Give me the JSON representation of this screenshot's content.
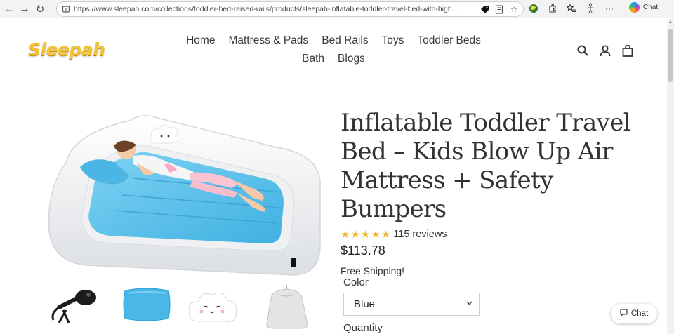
{
  "browser": {
    "url": "https://www.sleepah.com/collections/toddler-bed-raised-rails/products/sleepah-inflatable-toddler-travel-bed-with-high...",
    "chat_label": "Chat"
  },
  "header": {
    "logo_text": "Sleepah",
    "nav_row1": [
      "Home",
      "Mattress & Pads",
      "Bed Rails",
      "Toys",
      "Toddler Beds"
    ],
    "nav_row2": [
      "Bath",
      "Blogs"
    ],
    "active_nav": "Toddler Beds"
  },
  "product": {
    "title": "Inflatable Toddler Travel Bed – Kids Blow Up Air Mattress + Safety Bumpers",
    "rating_stars": 5,
    "reviews": "115 reviews",
    "price": "$113.78",
    "shipping": "Free Shipping!",
    "color_label": "Color",
    "color_value": "Blue",
    "quantity_label": "Quantity"
  },
  "colors": {
    "star": "#f3b52a",
    "mattress_blue": "#5bc0ea",
    "logo_yellow": "#f2c23a"
  },
  "chat_widget": {
    "label": "Chat"
  }
}
